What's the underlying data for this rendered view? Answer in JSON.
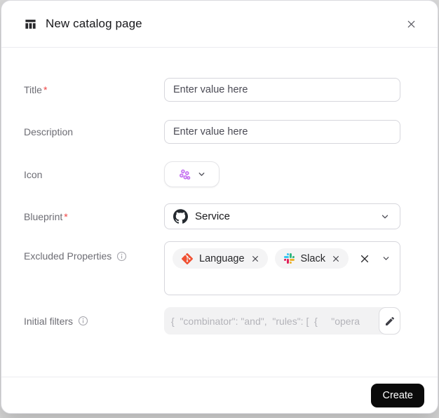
{
  "dialog": {
    "title": "New catalog page",
    "header_icon": "catalog-table-icon",
    "close_icon": "close-x-icon"
  },
  "form": {
    "required_marker": "*",
    "title": {
      "label": "Title",
      "required": true,
      "placeholder": "Enter value here",
      "value": ""
    },
    "description": {
      "label": "Description",
      "required": false,
      "placeholder": "Enter value here",
      "value": ""
    },
    "icon": {
      "label": "Icon",
      "selected_icon": "purple-cluster-icon"
    },
    "blueprint": {
      "label": "Blueprint",
      "required": true,
      "value": "Service",
      "value_icon": "github-icon"
    },
    "excluded_properties": {
      "label": "Excluded Properties",
      "info_icon": "info-icon",
      "chips": [
        {
          "label": "Language",
          "icon": "git-icon",
          "remove_icon": "x-icon"
        },
        {
          "label": "Slack",
          "icon": "slack-icon",
          "remove_icon": "x-icon"
        }
      ],
      "clear_icon": "x-icon",
      "dropdown_icon": "chevron-down-icon"
    },
    "initial_filters": {
      "label": "Initial filters",
      "info_icon": "info-icon",
      "value": "{  \"combinator\": \"and\",  \"rules\": [  {     \"opera",
      "edit_icon": "pencil-icon"
    }
  },
  "footer": {
    "create_label": "Create"
  },
  "colors": {
    "create_button_bg": "#0a0a0a",
    "required_asterisk": "#ef4444",
    "icon_purple": "#c26bf0",
    "git_orange": "#F05133",
    "slack_blue": "#36C5F0",
    "slack_green": "#2EB67D",
    "slack_yellow": "#ECB22E",
    "slack_red": "#E01E5A",
    "github_black": "#24292f"
  }
}
